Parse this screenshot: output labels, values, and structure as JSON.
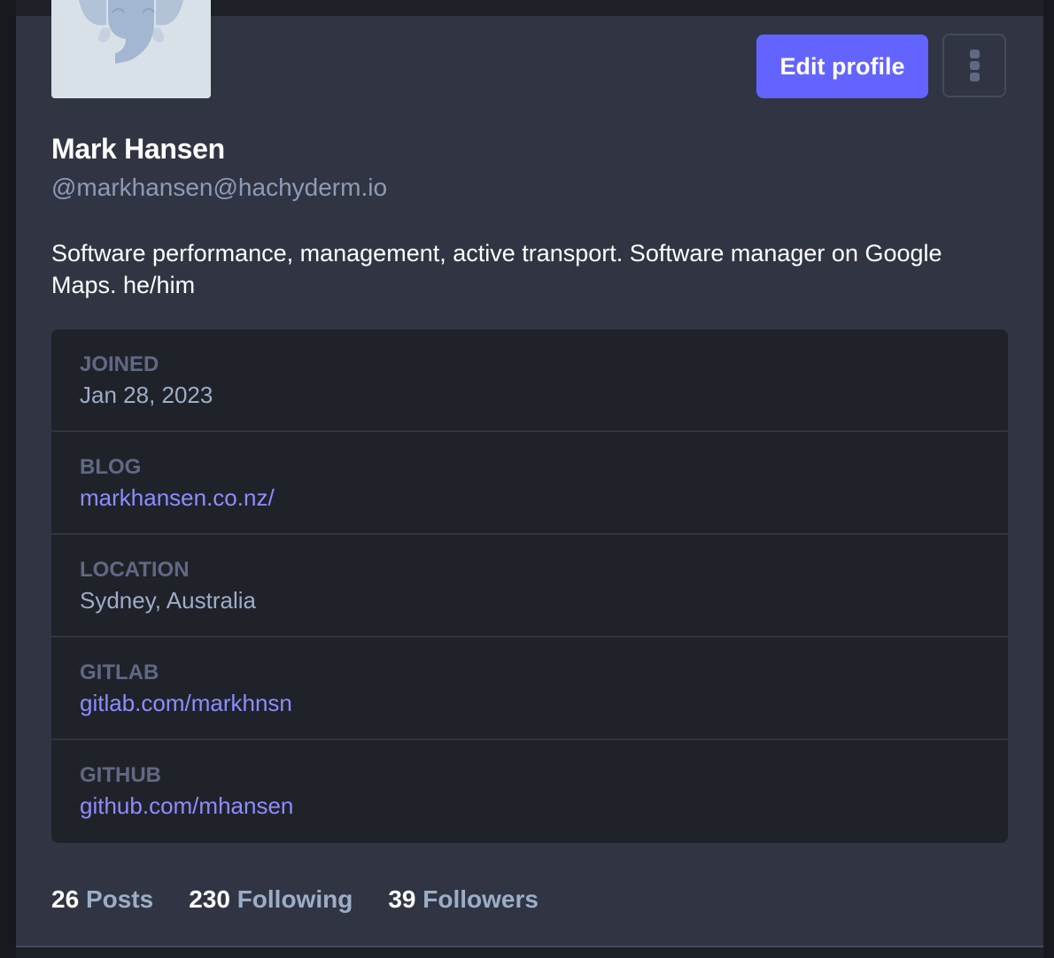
{
  "profile": {
    "display_name": "Mark Hansen",
    "handle": "@markhansen@hachyderm.io",
    "bio": "Software performance, management, active transport. Software manager on Google Maps. he/him",
    "avatar_icon": "mastodon-elephant-avatar"
  },
  "actions": {
    "edit_profile_label": "Edit profile",
    "more_menu_icon": "vertical-ellipsis-icon"
  },
  "fields": [
    {
      "label": "JOINED",
      "value": "Jan 28, 2023",
      "is_link": false
    },
    {
      "label": "BLOG",
      "value": "markhansen.co.nz/",
      "is_link": true
    },
    {
      "label": "LOCATION",
      "value": "Sydney, Australia",
      "is_link": false
    },
    {
      "label": "GITLAB",
      "value": "gitlab.com/markhnsn",
      "is_link": true
    },
    {
      "label": "GITHUB",
      "value": "github.com/mhansen",
      "is_link": true
    }
  ],
  "counts": {
    "posts": {
      "number": "26",
      "label": "Posts"
    },
    "following": {
      "number": "230",
      "label": "Following"
    },
    "followers": {
      "number": "39",
      "label": "Followers"
    }
  },
  "colors": {
    "accent": "#6364ff",
    "link": "#8c8dff",
    "panel_bg": "#313543",
    "fields_bg": "#202229",
    "muted_text": "#9baec8",
    "label_text": "#606984"
  }
}
